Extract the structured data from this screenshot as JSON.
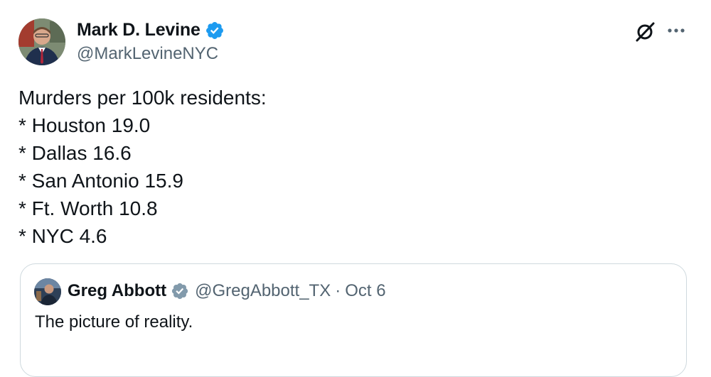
{
  "author": {
    "name": "Mark D. Levine",
    "handle": "@MarkLevineNYC",
    "verified_color": "#1d9bf0"
  },
  "tweet": {
    "lines": [
      "Murders per 100k residents:",
      "* Houston 19.0",
      "* Dallas 16.6",
      "* San Antonio 15.9",
      "* Ft. Worth 10.8",
      "* NYC 4.6"
    ]
  },
  "quote": {
    "name": "Greg Abbott",
    "handle": "@GregAbbott_TX",
    "separator": "·",
    "date": "Oct 6",
    "text": "The picture of reality.",
    "verified_color": "#829aab"
  },
  "icons": {
    "grok": "grok-icon",
    "more": "more-icon",
    "verified": "verified-badge-icon"
  },
  "colors": {
    "text": "#0f1419",
    "secondary": "#536471",
    "border": "#cfd9de"
  }
}
